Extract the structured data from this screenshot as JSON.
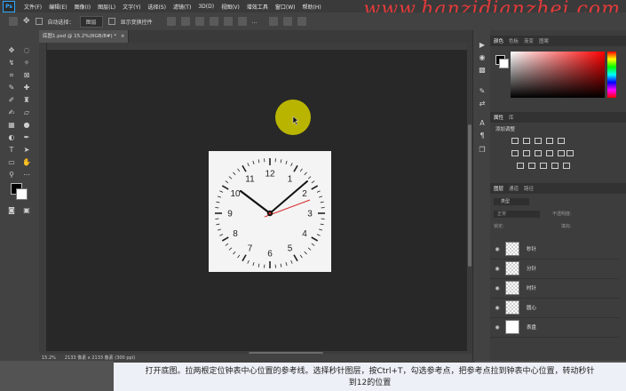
{
  "app": {
    "logo": "Ps"
  },
  "menu": [
    "文件(F)",
    "编辑(E)",
    "图像(I)",
    "图层(L)",
    "文字(Y)",
    "选择(S)",
    "滤镜(T)",
    "3D(D)",
    "视图(V)",
    "增效工具",
    "窗口(W)",
    "帮助(H)"
  ],
  "watermark": "www.hanzidianzhei.com",
  "options": {
    "auto_select_label": "自动选择：",
    "auto_select_value": "图层",
    "show_transform_label": "显示变换控件",
    "more": "..."
  },
  "document": {
    "tab_title": "底图1.psd @ 15.2%(RGB/8#) *",
    "close": "×"
  },
  "status": {
    "zoom": "15.2%",
    "info": "2133 像素 x 2133 像素 (300 ppi)"
  },
  "color_panel": {
    "tabs": [
      "颜色",
      "色板",
      "渐变",
      "图案"
    ]
  },
  "adjust_panel": {
    "tabs": [
      "属性",
      "库"
    ],
    "title": "添加调整"
  },
  "layers_panel": {
    "tabs": [
      "图层",
      "通道",
      "路径"
    ],
    "filter": "类型",
    "mode": "正常",
    "opacity_label": "不透明度:",
    "lock_label": "锁定:",
    "fill_label": "填充:",
    "layers": [
      {
        "name": "秒针"
      },
      {
        "name": "分针"
      },
      {
        "name": "时针"
      },
      {
        "name": "圆心"
      },
      {
        "name": "表盘"
      }
    ]
  },
  "clock": {
    "numbers": [
      "12",
      "1",
      "2",
      "3",
      "4",
      "5",
      "6",
      "7",
      "8",
      "9",
      "10",
      "11"
    ]
  },
  "caption": {
    "line1": "打开底图。拉两根定位钟表中心位置的参考线。选择秒针图层，按Ctrl+T，勾选参考点，把参考点拉到钟表中心位置，转动秒针",
    "line2": "到12的位置"
  },
  "colors": {
    "accent": "#31a8ff",
    "watermark": "#e23a3a",
    "second_hand": "#d62b2b",
    "cursor_highlight": "#b9b400"
  }
}
